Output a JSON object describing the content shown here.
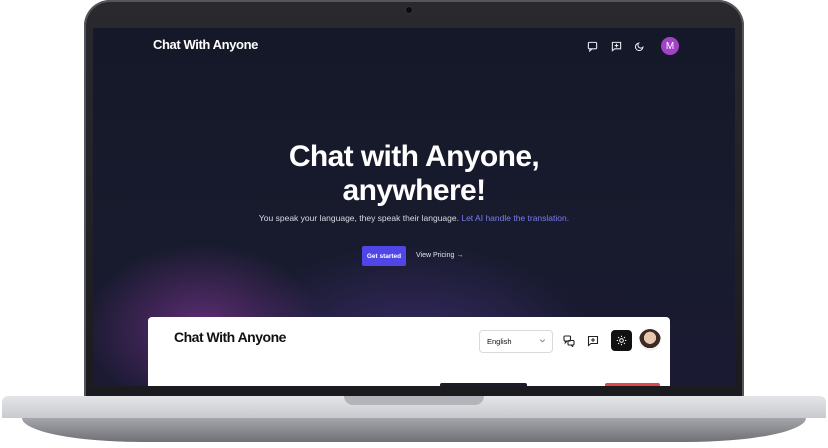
{
  "nav": {
    "brand": "Chat With Anyone",
    "icons": [
      "chat-bubble-icon",
      "message-plus-icon",
      "moon-icon"
    ],
    "avatar_letter": "M"
  },
  "hero": {
    "title_line1": "Chat with Anyone,",
    "title_line2": "anywhere!",
    "subtitle": "You speak your language, they speak their language.",
    "subtitle_highlight": "Let AI handle the translation.",
    "cta_label": "Get started",
    "pricing_label": "View Pricing →"
  },
  "preview": {
    "brand": "Chat With Anyone",
    "language_select": "English",
    "icons": [
      "translate-chat-icon",
      "message-plus-icon",
      "sun-icon",
      "profile-photo"
    ]
  },
  "colors": {
    "screen_bg": "#141828",
    "accent": "#4f46e5",
    "highlight_text": "#7b7cf0",
    "avatar_bg": "#a243c7"
  }
}
